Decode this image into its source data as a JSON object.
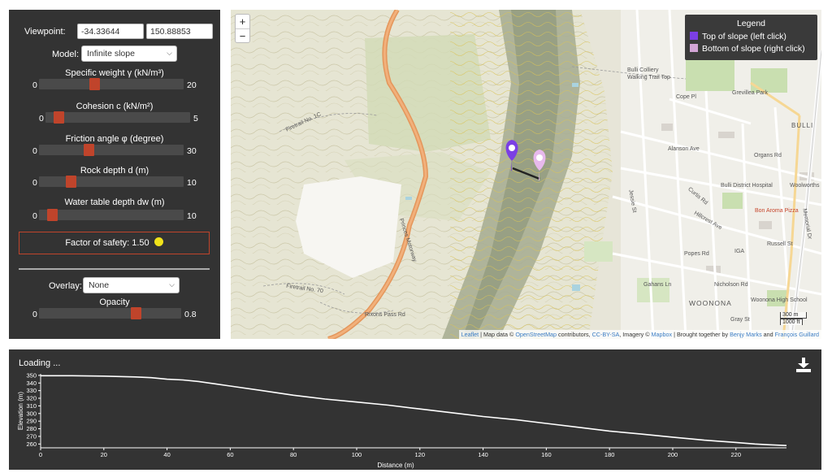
{
  "controls": {
    "viewpoint_label": "Viewpoint:",
    "viewpoint_lat": "-34.33644",
    "viewpoint_lon": "150.88853",
    "model_label": "Model:",
    "model_value": "Infinite slope",
    "sliders": [
      {
        "label": "Specific weight γ (kN/m³)",
        "min": "0",
        "max": "20",
        "value": 7.5
      },
      {
        "label": "Cohesion c (kN/m²)",
        "min": "0",
        "max": "5",
        "value": 0.3
      },
      {
        "label": "Friction angle φ (degree)",
        "min": "0",
        "max": "30",
        "value": 10
      },
      {
        "label": "Rock depth d (m)",
        "min": "0",
        "max": "10",
        "value": 2.0
      },
      {
        "label": "Water table depth dw (m)",
        "min": "0",
        "max": "10",
        "value": 0.6
      }
    ],
    "factor_of_safety": "Factor of safety: 1.50",
    "overlay_label": "Overlay:",
    "overlay_value": "None",
    "opacity_label": "Opacity",
    "opacity_min": "0",
    "opacity_max": "0.8",
    "opacity_value": 0.56
  },
  "map": {
    "zoom_in": "+",
    "zoom_out": "−",
    "legend": {
      "title": "Legend",
      "items": [
        {
          "label": "Top of slope (left click)",
          "color": "#7b3fe4"
        },
        {
          "label": "Bottom of slope (right click)",
          "color": "#d3a5d6"
        }
      ]
    },
    "labels": [
      "Bulli Colliery Walking Trail Top",
      "Grevillea Park",
      "BULLI",
      "Cope Pl",
      "Alanson Ave",
      "Organs Rd",
      "Bulli District Hospital",
      "Woolworths",
      "Bon Aroma Pizza",
      "Russell St",
      "IGA",
      "Popes Rd",
      "Gahans Ln",
      "Nicholson Rd",
      "WOONONA",
      "Woonona High School",
      "Gray St",
      "Firetrail No. 1C",
      "Firetrail No. 70",
      "Rixons Pass Rd",
      "Princes Motorway",
      "Curtis Rd",
      "Hillcrest Ave",
      "Jessie St",
      "Memorial Dr"
    ],
    "scale_m": "300 m",
    "scale_ft": "1000 ft",
    "attribution": {
      "leaflet": "Leaflet",
      "text1": " | Map data © ",
      "osm": "OpenStreetMap",
      "text2": " contributors, ",
      "license": "CC-BY-SA",
      "text3": ", Imagery © ",
      "mapbox": "Mapbox",
      "text4": " | Brought together by ",
      "author1": "Benjy Marks",
      "text5": " and ",
      "author2": "François Guillard"
    },
    "colors": {
      "top_marker": "#7b3fe4",
      "bottom_marker": "#e7b9ec",
      "line": "#222222"
    }
  },
  "profile": {
    "status": "Loading ...",
    "download_icon": "download-icon",
    "chart_data": {
      "type": "line",
      "title": "",
      "xlabel": "Distance (m)",
      "ylabel": "Elevation (m)",
      "xlim": [
        0,
        236
      ],
      "ylim": [
        255,
        352
      ],
      "xticks": [
        0,
        20,
        40,
        60,
        80,
        100,
        120,
        140,
        160,
        180,
        200,
        220
      ],
      "yticks": [
        260,
        270,
        280,
        290,
        300,
        310,
        320,
        330,
        340,
        350
      ],
      "grid": false,
      "series": [
        {
          "name": "",
          "x": [
            0,
            10,
            20,
            25,
            30,
            35,
            40,
            45,
            50,
            55,
            60,
            70,
            80,
            90,
            100,
            110,
            120,
            130,
            140,
            150,
            160,
            170,
            180,
            190,
            200,
            210,
            220,
            226,
            230,
            236
          ],
          "y": [
            349.5,
            349.5,
            349,
            348.5,
            348,
            347,
            345,
            344,
            342,
            339,
            336,
            330,
            324,
            319,
            315,
            311,
            306,
            301,
            296,
            292,
            287,
            282,
            277,
            273,
            269,
            265,
            262,
            260,
            259,
            258
          ]
        }
      ]
    }
  }
}
